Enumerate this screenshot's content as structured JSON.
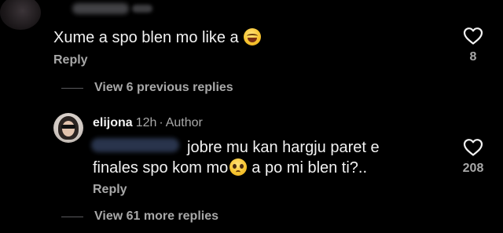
{
  "top_comment": {
    "text": "Xume a spo blen mo like a",
    "emoji_icon": "face-with-tears-of-joy-icon",
    "reply_label": "Reply",
    "like_count": "8"
  },
  "view_previous": {
    "label": "View 6 previous replies"
  },
  "reply_comment": {
    "username": "elijona",
    "time": "12h",
    "separator": "·",
    "role": "Author",
    "text_line1": "jobre mu kan hargju paret e",
    "text_line2_before": "finales spo kom mo",
    "emoji_icon": "pleading-face-icon",
    "text_line2_after": "a po mi blen ti?..",
    "reply_label": "Reply",
    "like_count": "208"
  },
  "view_more": {
    "label": "View 61 more replies"
  },
  "colors": {
    "background": "#000000",
    "primary_text": "#f2f2f2",
    "secondary_text": "#a8a8a8"
  }
}
